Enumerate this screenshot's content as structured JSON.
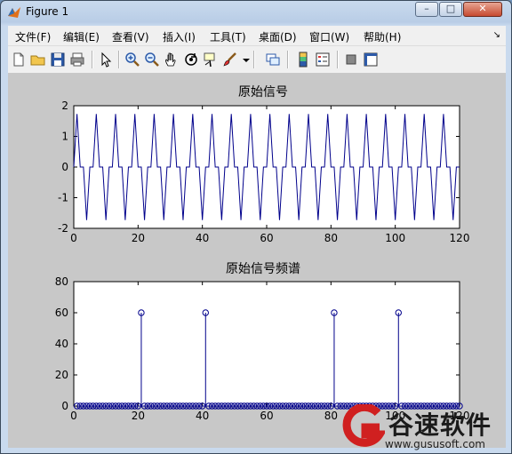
{
  "window": {
    "title": "Figure 1",
    "controls": {
      "minimize": "–",
      "maximize": "□",
      "close": "✕"
    }
  },
  "menus": [
    "文件(F)",
    "编辑(E)",
    "查看(V)",
    "插入(I)",
    "工具(T)",
    "桌面(D)",
    "窗口(W)",
    "帮助(H)"
  ],
  "toolbar_icons": [
    "new-figure-icon",
    "open-file-icon",
    "save-icon",
    "print-icon",
    "edit-plot-arrow-icon",
    "zoom-in-icon",
    "zoom-out-icon",
    "pan-hand-icon",
    "rotate-3d-icon",
    "data-cursor-icon",
    "brush-icon",
    "dropdown-arrow-icon",
    "link-plot-icon",
    "insert-colorbar-icon",
    "insert-legend-icon",
    "hide-plot-tools-icon",
    "show-plot-tools-icon"
  ],
  "colors": {
    "line": "#00008b",
    "axes_bg": "#ffffff",
    "figure_bg": "#c8c8c8"
  },
  "chart_data": [
    {
      "type": "line",
      "title": "原始信号",
      "xlim": [
        0,
        120
      ],
      "ylim": [
        -2,
        2
      ],
      "xticks": [
        0,
        20,
        40,
        60,
        80,
        100,
        120
      ],
      "yticks": [
        -2,
        -1,
        0,
        1,
        2
      ],
      "series": [
        {
          "period": 6,
          "pattern": [
            0,
            1.732,
            0,
            0,
            -1.732,
            0
          ],
          "x": [
            0,
            120
          ]
        }
      ]
    },
    {
      "type": "stem",
      "title": "原始信号频谱",
      "xlim": [
        0,
        120
      ],
      "ylim": [
        0,
        80
      ],
      "xticks": [
        0,
        20,
        40,
        60,
        80,
        100,
        120
      ],
      "yticks": [
        0,
        20,
        40,
        60,
        80
      ],
      "series": [
        {
          "x_range": [
            1,
            120
          ],
          "peaks": [
            {
              "x": 21,
              "y": 60
            },
            {
              "x": 41,
              "y": 60
            },
            {
              "x": 81,
              "y": 60
            },
            {
              "x": 101,
              "y": 60
            }
          ]
        }
      ]
    }
  ],
  "watermark": {
    "brand": "谷速软件",
    "url": "www.gususoft.com"
  }
}
